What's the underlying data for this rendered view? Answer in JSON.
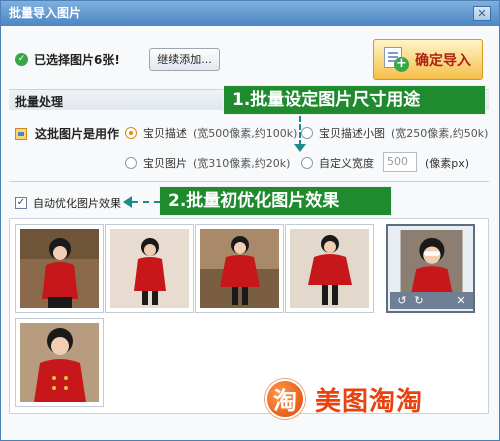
{
  "window": {
    "title": "批量导入图片",
    "close_label": "✕"
  },
  "status": {
    "selected_text": "已选择图片6张!",
    "add_more_label": "继续添加..."
  },
  "confirm": {
    "label": "确定导入"
  },
  "batch": {
    "section_title": "批量处理"
  },
  "usage": {
    "label": "这批图片是用作",
    "options": [
      {
        "label": "宝贝描述",
        "desc": "(宽500像素,约100k)",
        "checked": true
      },
      {
        "label": "宝贝描述小图",
        "desc": "(宽250像素,约50k)",
        "checked": false
      },
      {
        "label": "宝贝图片",
        "desc": "(宽310像素,约20k)",
        "checked": false
      },
      {
        "label": "自定义宽度",
        "desc": "",
        "checked": false
      }
    ],
    "custom_width_value": "500",
    "custom_unit": "(像素px)"
  },
  "optimize": {
    "label": "自动优化图片效果",
    "checked": true
  },
  "annotations": {
    "a1": "1.批量设定图片尺寸用途",
    "a2": "2.批量初优化图片效果"
  },
  "thumbnail_toolbar": {
    "rotate_left": "↺",
    "rotate_right": "↻",
    "remove": "✕"
  },
  "thumbnails": [
    {
      "name": "photo-1"
    },
    {
      "name": "photo-2"
    },
    {
      "name": "photo-3"
    },
    {
      "name": "photo-4"
    },
    {
      "name": "photo-5",
      "selected": true
    },
    {
      "name": "photo-6"
    }
  ],
  "logo": {
    "badge": "淘",
    "text": "美图淘淘"
  },
  "colors": {
    "accent_red": "#c81e12",
    "annotation_green": "#1f8a2e",
    "title_blue": "#4c86c2"
  }
}
